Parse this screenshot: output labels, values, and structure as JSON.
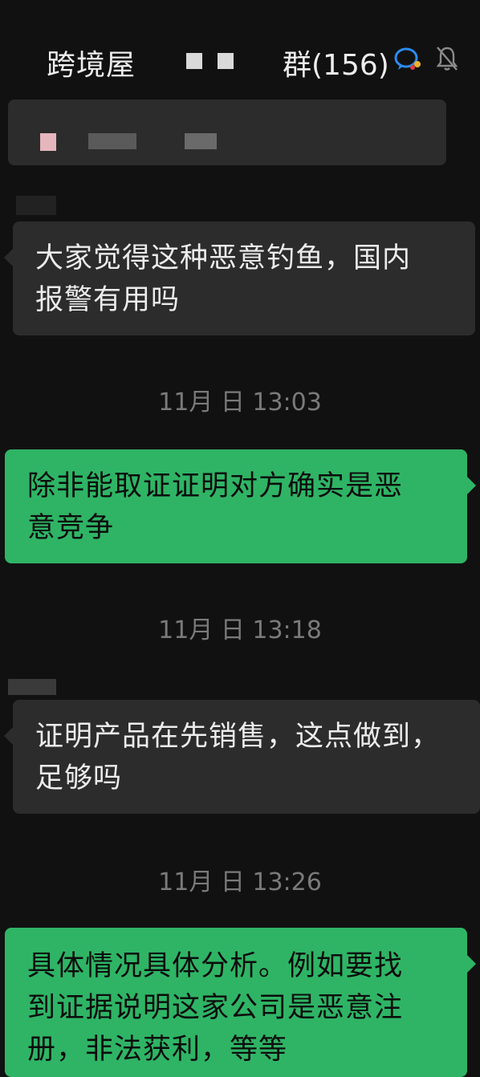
{
  "header": {
    "title_left": "跨境屋",
    "title_right": "群(156)",
    "icons": [
      "chat-bubble-icon",
      "bell-muted-icon"
    ],
    "accent": "#2fb465"
  },
  "messages": [
    {
      "side": "in",
      "text_line1": "大家觉得这种恶意钓鱼，国内",
      "text_line2": "报警有用吗"
    },
    {
      "side": "time",
      "text": "11月 日 13:03"
    },
    {
      "side": "out",
      "text_line1": "除非能取证证明对方确实是恶",
      "text_line2": "意竞争"
    },
    {
      "side": "time",
      "text": "11月 日 13:18"
    },
    {
      "side": "in",
      "text_line1": "证明产品在先销售，这点做到，",
      "text_line2": "足够吗"
    },
    {
      "side": "time",
      "text": "11月 日 13:26"
    },
    {
      "side": "out",
      "text_line1": "具体情况具体分析。例如要找",
      "text_line2": "到证据说明这家公司是恶意注",
      "text_line3": "册，非法获利，等等"
    }
  ]
}
